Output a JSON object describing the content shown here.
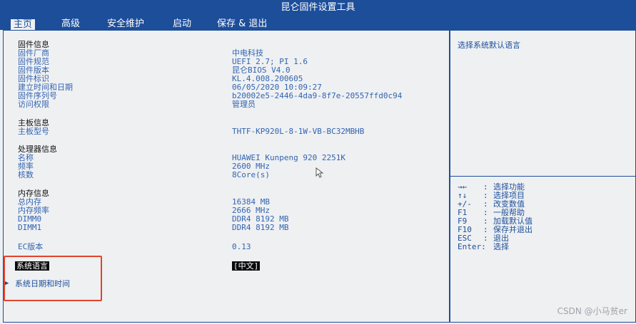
{
  "window": {
    "title": "昆仑固件设置工具"
  },
  "menu": [
    {
      "label": "主页",
      "active": true
    },
    {
      "label": "高级",
      "active": false
    },
    {
      "label": "安全维护",
      "active": false
    },
    {
      "label": "启动",
      "active": false
    },
    {
      "label": "保存 & 退出",
      "active": false
    }
  ],
  "firmware": {
    "header": "固件信息",
    "rows": [
      {
        "label": "固件厂商",
        "value": "中电科技"
      },
      {
        "label": "固件规范",
        "value": "UEFI 2.7; PI 1.6"
      },
      {
        "label": "固件版本",
        "value": "昆仑BIOS V4.0"
      },
      {
        "label": "固件标识",
        "value": "KL.4.008.200605"
      },
      {
        "label": "建立时间和日期",
        "value": "06/05/2020 10:09:27"
      },
      {
        "label": "固件序列号",
        "value": "b20002e5-2446-4da9-8f7e-20557ffd0c94"
      },
      {
        "label": "访问权限",
        "value": "管理员"
      }
    ]
  },
  "board": {
    "header": "主板信息",
    "rows": [
      {
        "label": "主板型号",
        "value": "THTF-KP920L-8-1W-VB-BC32MBHB"
      }
    ]
  },
  "cpu": {
    "header": "处理器信息",
    "rows": [
      {
        "label": "名称",
        "value": "HUAWEI Kunpeng 920 2251K"
      },
      {
        "label": "频率",
        "value": "2600 MHz"
      },
      {
        "label": "核数",
        "value": "8Core(s)"
      }
    ]
  },
  "memory": {
    "header": "内存信息",
    "rows": [
      {
        "label": "总内存",
        "value": "16384 MB"
      },
      {
        "label": "内存频率",
        "value": "2666 MHz"
      },
      {
        "label": "DIMM0",
        "value": "DDR4 8192 MB"
      },
      {
        "label": "DIMM1",
        "value": "DDR4 8192 MB"
      }
    ]
  },
  "ec": {
    "label": "EC版本",
    "value": "0.13"
  },
  "language": {
    "label": "系统语言",
    "value": "[中文]"
  },
  "datetime": {
    "label": "系统日期和时间"
  },
  "help": {
    "description": "选择系统默认语言",
    "keys": [
      {
        "key": "→←",
        "action": "选择功能"
      },
      {
        "key": "↑↓",
        "action": "选择项目"
      },
      {
        "key": "+/-",
        "action": "改变数值"
      },
      {
        "key": "F1",
        "action": "一般帮助"
      },
      {
        "key": "F9",
        "action": "加载默认值"
      },
      {
        "key": "F10",
        "action": "保存并退出"
      },
      {
        "key": "ESC",
        "action": "退出"
      },
      {
        "key": "Enter:",
        "action": "选择"
      }
    ]
  },
  "watermark": "CSDN @小马贫er",
  "colors": {
    "accent": "#1c4e9a",
    "highlight": "#e0452c"
  }
}
